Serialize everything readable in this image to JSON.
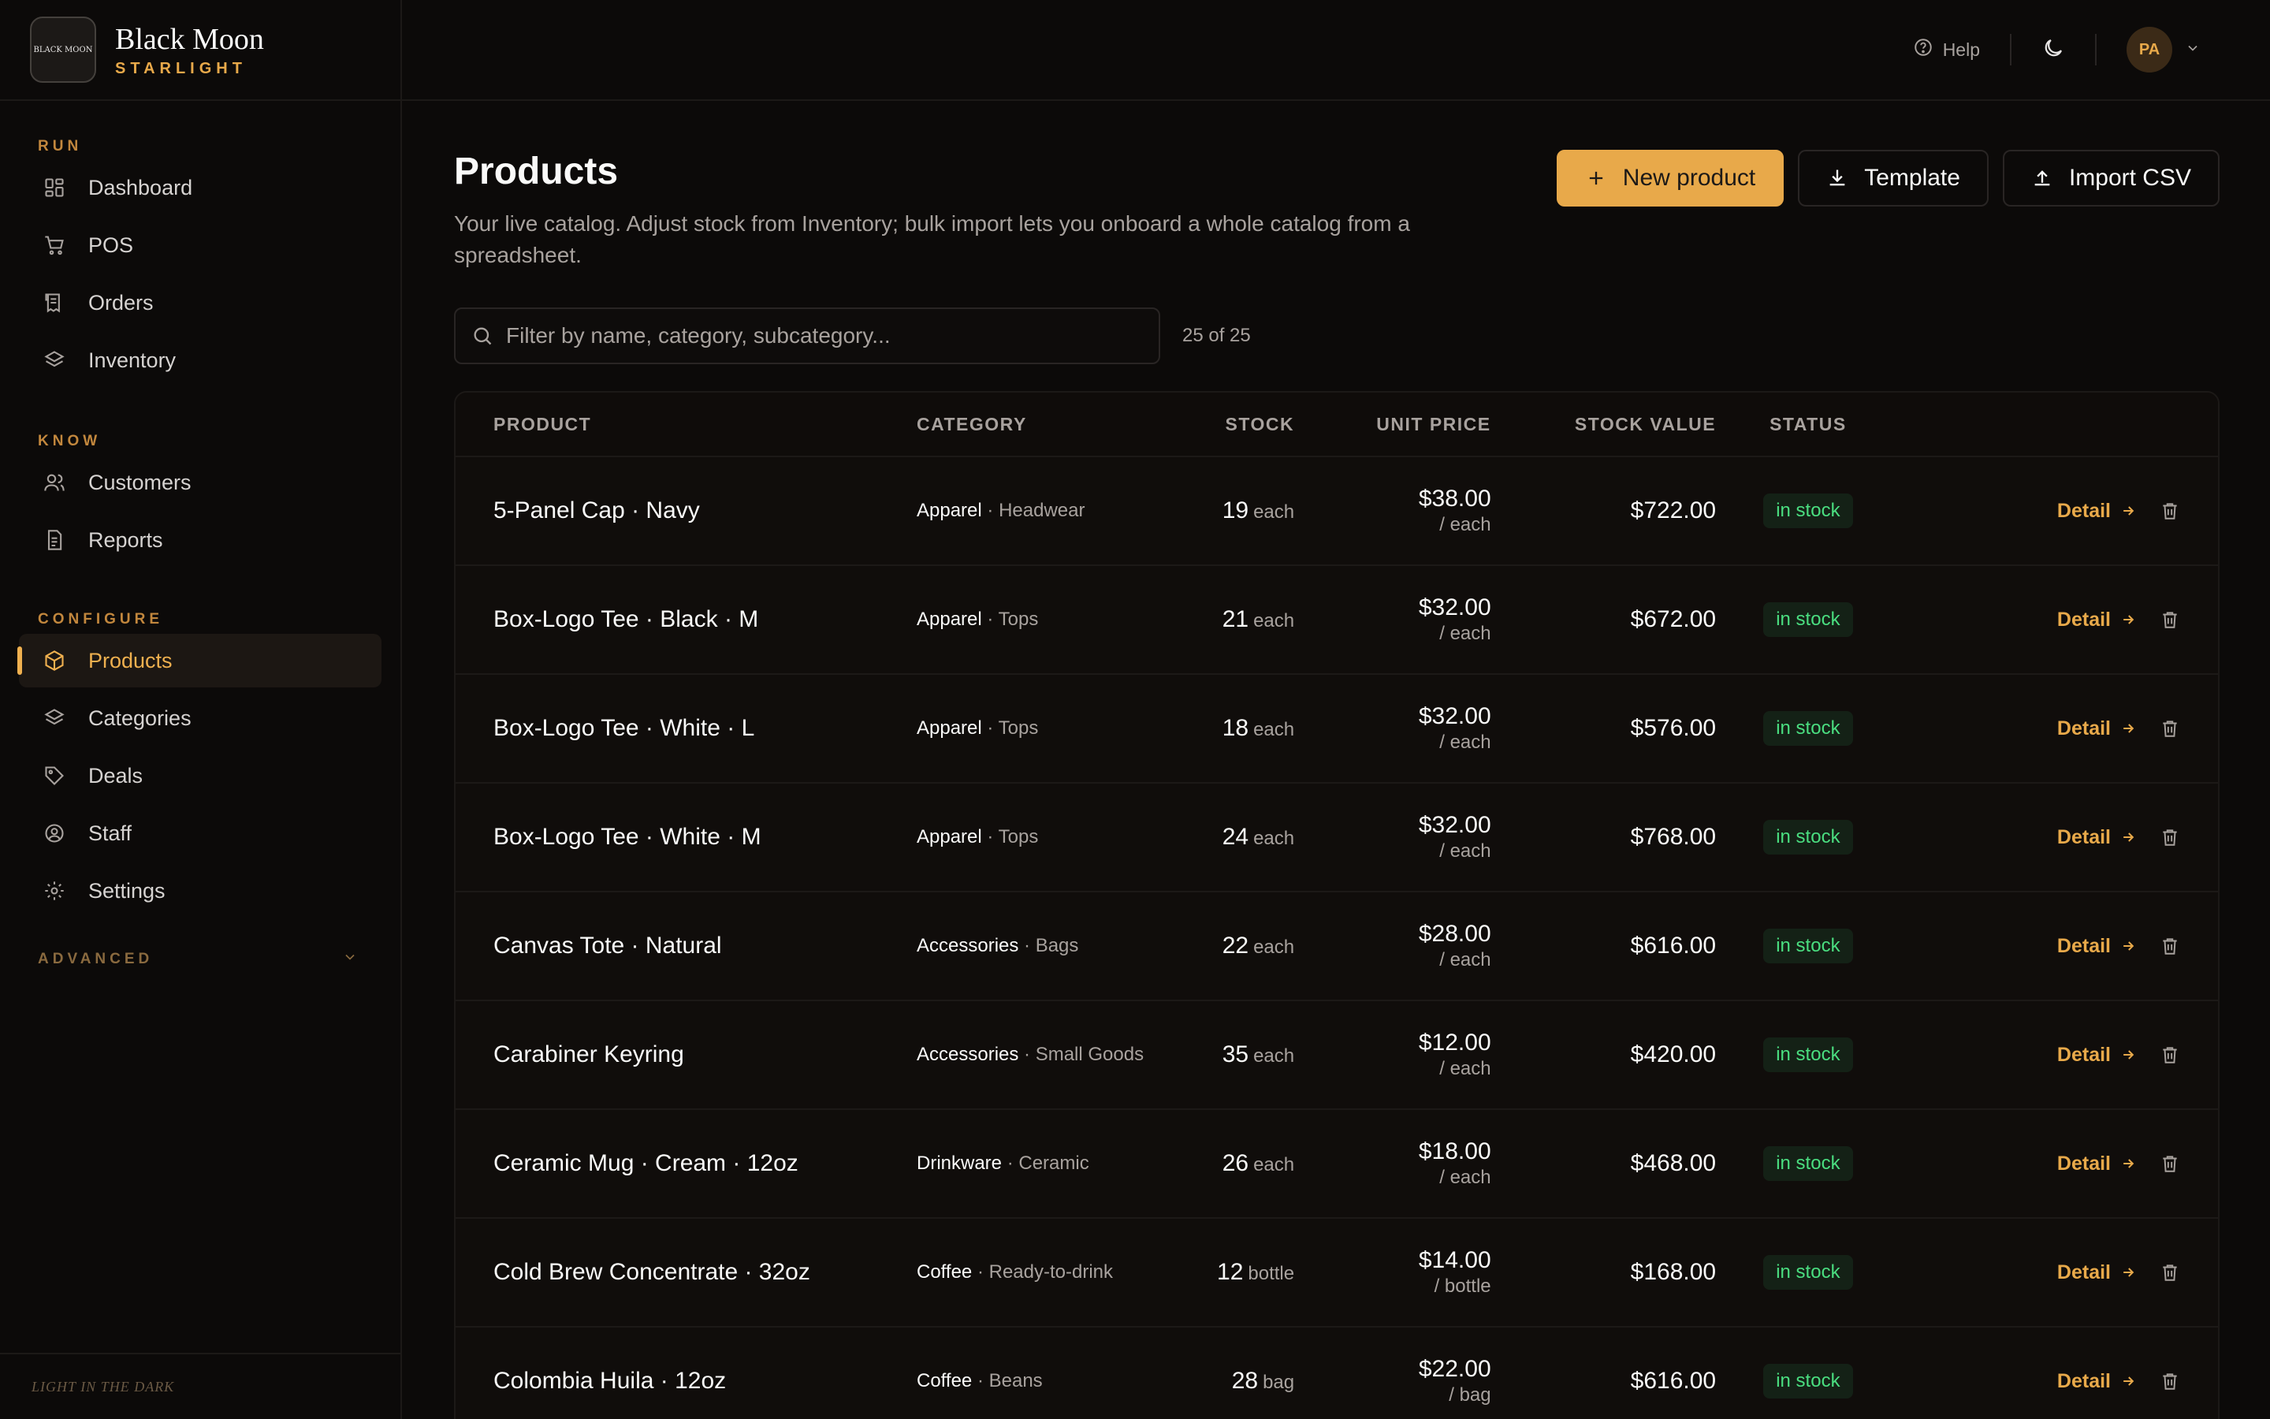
{
  "brand": {
    "name": "Black Moon",
    "subtitle": "STARLIGHT",
    "logo_text": "BLACK MOON",
    "footer": "LIGHT IN THE DARK"
  },
  "sidebar": {
    "sections": [
      {
        "label": "RUN",
        "items": [
          {
            "label": "Dashboard",
            "icon": "dashboard-icon"
          },
          {
            "label": "POS",
            "icon": "cart-icon"
          },
          {
            "label": "Orders",
            "icon": "receipt-icon"
          },
          {
            "label": "Inventory",
            "icon": "layers-icon"
          }
        ]
      },
      {
        "label": "KNOW",
        "items": [
          {
            "label": "Customers",
            "icon": "users-icon"
          },
          {
            "label": "Reports",
            "icon": "report-icon"
          }
        ]
      },
      {
        "label": "CONFIGURE",
        "items": [
          {
            "label": "Products",
            "icon": "box-icon",
            "active": true
          },
          {
            "label": "Categories",
            "icon": "layers-icon"
          },
          {
            "label": "Deals",
            "icon": "tag-icon"
          },
          {
            "label": "Staff",
            "icon": "user-circle-icon"
          },
          {
            "label": "Settings",
            "icon": "gear-icon"
          }
        ]
      }
    ],
    "advanced_label": "ADVANCED"
  },
  "topbar": {
    "help_label": "Help",
    "avatar_initials": "PA"
  },
  "page": {
    "title": "Products",
    "description": "Your live catalog. Adjust stock from Inventory; bulk import lets you onboard a whole catalog from a spreadsheet.",
    "new_product_label": "New product",
    "template_label": "Template",
    "import_label": "Import CSV",
    "filter_placeholder": "Filter by name, category, subcategory...",
    "count_text": "25 of 25"
  },
  "table": {
    "headers": {
      "product": "PRODUCT",
      "category": "CATEGORY",
      "stock": "STOCK",
      "unit_price": "UNIT PRICE",
      "stock_value": "STOCK VALUE",
      "status": "STATUS"
    },
    "detail_label": "Detail",
    "rows": [
      {
        "name": "5-Panel Cap · Navy",
        "category": "Apparel",
        "subcategory": " · Headwear",
        "stock": "19",
        "unit": "each",
        "price": "$38.00",
        "price_unit": "/ each",
        "value": "$722.00",
        "status": "in stock"
      },
      {
        "name": "Box-Logo Tee · Black · M",
        "category": "Apparel",
        "subcategory": " · Tops",
        "stock": "21",
        "unit": "each",
        "price": "$32.00",
        "price_unit": "/ each",
        "value": "$672.00",
        "status": "in stock"
      },
      {
        "name": "Box-Logo Tee · White · L",
        "category": "Apparel",
        "subcategory": " · Tops",
        "stock": "18",
        "unit": "each",
        "price": "$32.00",
        "price_unit": "/ each",
        "value": "$576.00",
        "status": "in stock"
      },
      {
        "name": "Box-Logo Tee · White · M",
        "category": "Apparel",
        "subcategory": " · Tops",
        "stock": "24",
        "unit": "each",
        "price": "$32.00",
        "price_unit": "/ each",
        "value": "$768.00",
        "status": "in stock"
      },
      {
        "name": "Canvas Tote · Natural",
        "category": "Accessories",
        "subcategory": " · Bags",
        "stock": "22",
        "unit": "each",
        "price": "$28.00",
        "price_unit": "/ each",
        "value": "$616.00",
        "status": "in stock"
      },
      {
        "name": "Carabiner Keyring",
        "category": "Accessories",
        "subcategory": " · Small Goods",
        "stock": "35",
        "unit": "each",
        "price": "$12.00",
        "price_unit": "/ each",
        "value": "$420.00",
        "status": "in stock"
      },
      {
        "name": "Ceramic Mug · Cream · 12oz",
        "category": "Drinkware",
        "subcategory": " · Ceramic",
        "stock": "26",
        "unit": "each",
        "price": "$18.00",
        "price_unit": "/ each",
        "value": "$468.00",
        "status": "in stock"
      },
      {
        "name": "Cold Brew Concentrate · 32oz",
        "category": "Coffee",
        "subcategory": " · Ready-to-drink",
        "stock": "12",
        "unit": "bottle",
        "price": "$14.00",
        "price_unit": "/ bottle",
        "value": "$168.00",
        "status": "in stock"
      },
      {
        "name": "Colombia Huila · 12oz",
        "category": "Coffee",
        "subcategory": " · Beans",
        "stock": "28",
        "unit": "bag",
        "price": "$22.00",
        "price_unit": "/ bag",
        "value": "$616.00",
        "status": "in stock"
      }
    ]
  },
  "colors": {
    "accent": "#e8a94a",
    "background": "#0c0a09",
    "status_green": "#4ade80"
  }
}
